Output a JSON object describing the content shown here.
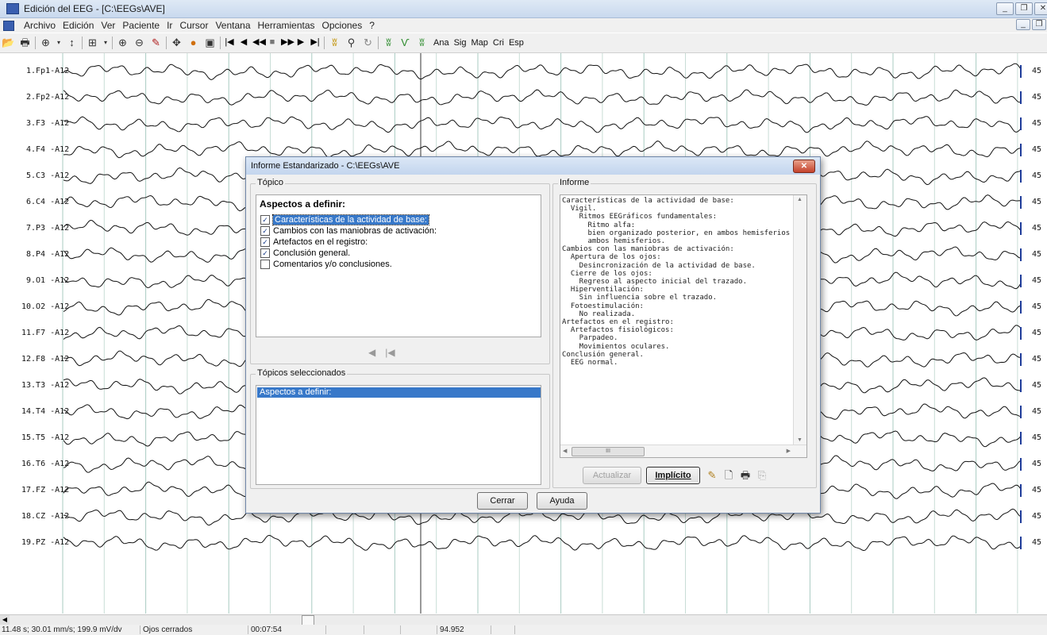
{
  "window": {
    "title": "Edición del EEG - [C:\\EEGs\\AVE]",
    "controls": [
      "_",
      "❐",
      "✕"
    ]
  },
  "menu": [
    "Archivo",
    "Edición",
    "Ver",
    "Paciente",
    "Ir",
    "Cursor",
    "Ventana",
    "Herramientas",
    "Opciones",
    "?"
  ],
  "toolbar": {
    "text_buttons": [
      "Ana",
      "Sig",
      "Map",
      "Cri",
      "Esp"
    ]
  },
  "channels": [
    {
      "label": "1.Fp1-A12",
      "scale": "45"
    },
    {
      "label": "2.Fp2-A12",
      "scale": "45"
    },
    {
      "label": "3.F3 -A12",
      "scale": "45"
    },
    {
      "label": "4.F4 -A12",
      "scale": "45"
    },
    {
      "label": "5.C3 -A12",
      "scale": "45"
    },
    {
      "label": "6.C4 -A12",
      "scale": "45"
    },
    {
      "label": "7.P3 -A12",
      "scale": "45"
    },
    {
      "label": "8.P4 -A12",
      "scale": "45"
    },
    {
      "label": "9.O1 -A12",
      "scale": "45"
    },
    {
      "label": "10.O2 -A12",
      "scale": "45"
    },
    {
      "label": "11.F7 -A12",
      "scale": "45"
    },
    {
      "label": "12.F8 -A12",
      "scale": "45"
    },
    {
      "label": "13.T3 -A12",
      "scale": "45"
    },
    {
      "label": "14.T4 -A12",
      "scale": "45"
    },
    {
      "label": "15.T5 -A12",
      "scale": "45"
    },
    {
      "label": "16.T6 -A12",
      "scale": "45"
    },
    {
      "label": "17.FZ -A12",
      "scale": "45"
    },
    {
      "label": "18.CZ -A12",
      "scale": "45"
    },
    {
      "label": "19.PZ -A12",
      "scale": "45"
    }
  ],
  "status": {
    "speed": "11.48 s; 30.01 mm/s; 199.9 mV/dv",
    "state": "Ojos cerrados",
    "time": "00:07:54",
    "value": "94.952"
  },
  "dialog": {
    "title": "Informe Estandarizado - C:\\EEGs\\AVE",
    "topic_group": "Tópico",
    "topic_heading": "Aspectos a definir:",
    "topics": [
      {
        "label": "Características de la actividad de base:",
        "checked": true,
        "selected": true
      },
      {
        "label": "Cambios con las maniobras de activación:",
        "checked": true,
        "selected": false
      },
      {
        "label": "Artefactos en el registro:",
        "checked": true,
        "selected": false
      },
      {
        "label": "Conclusión general.",
        "checked": true,
        "selected": false
      },
      {
        "label": "Comentarios y/o conclusiones.",
        "checked": false,
        "selected": false
      }
    ],
    "selected_group": "Tópicos seleccionados",
    "selected_items": [
      "Aspectos a definir:"
    ],
    "report_group": "Informe",
    "report_lines": [
      "Características de la actividad de base:",
      "  Vigil.",
      "    Ritmos EEGráficos fundamentales:",
      "      Ritmo alfa:",
      "      bien organizado posterior, en ambos hemisferios",
      "      ambos hemisferios.",
      "Cambios con las maniobras de activación:",
      "  Apertura de los ojos:",
      "    Desincronización de la actividad de base.",
      "  Cierre de los ojos:",
      "    Regreso al aspecto inicial del trazado.",
      "  Hiperventilación:",
      "    Sin influencia sobre el trazado.",
      "  Fotoestimulación:",
      "    No realizada.",
      "Artefactos en el registro:",
      "  Artefactos fisiológicos:",
      "    Parpadeo.",
      "    Movimientos oculares.",
      "Conclusión general.",
      "  EEG normal."
    ],
    "buttons": {
      "update": "Actualizar",
      "implicit": "Implícito",
      "close": "Cerrar",
      "help": "Ayuda"
    }
  }
}
